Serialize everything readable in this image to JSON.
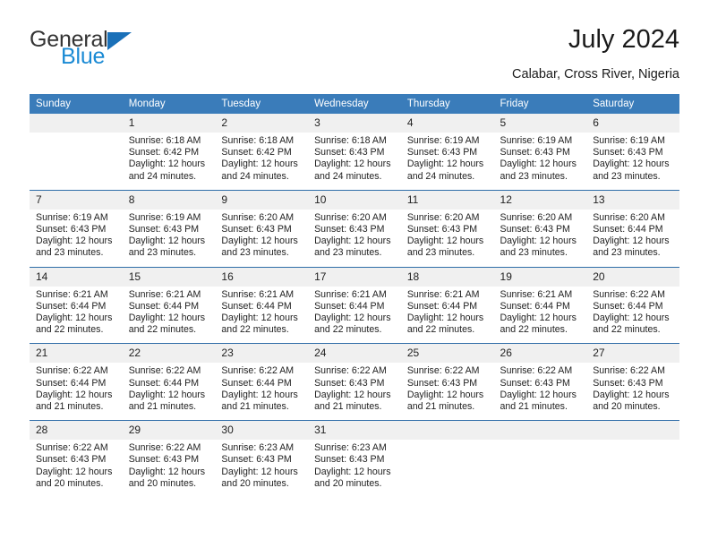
{
  "brand": {
    "name_part1": "General",
    "name_part2": "Blue",
    "triangle_icon": "triangle-icon",
    "accent_color": "#1a8ad4",
    "triangle_color": "#1a70b8"
  },
  "header": {
    "title": "July 2024",
    "location": "Calabar, Cross River, Nigeria"
  },
  "theme": {
    "header_bg": "#3a7cba",
    "row_divider": "#2f6da8",
    "daynum_bg": "#f0f0f0"
  },
  "weekdays": [
    "Sunday",
    "Monday",
    "Tuesday",
    "Wednesday",
    "Thursday",
    "Friday",
    "Saturday"
  ],
  "labels": {
    "sunrise_prefix": "Sunrise: ",
    "sunset_prefix": "Sunset: ",
    "daylight_prefix": "Daylight: "
  },
  "weeks": [
    [
      {
        "day": "",
        "sunrise": "",
        "sunset": "",
        "daylight_line1": "",
        "daylight_line2": "",
        "empty": true
      },
      {
        "day": "1",
        "sunrise": "Sunrise: 6:18 AM",
        "sunset": "Sunset: 6:42 PM",
        "daylight_line1": "Daylight: 12 hours",
        "daylight_line2": "and 24 minutes."
      },
      {
        "day": "2",
        "sunrise": "Sunrise: 6:18 AM",
        "sunset": "Sunset: 6:42 PM",
        "daylight_line1": "Daylight: 12 hours",
        "daylight_line2": "and 24 minutes."
      },
      {
        "day": "3",
        "sunrise": "Sunrise: 6:18 AM",
        "sunset": "Sunset: 6:43 PM",
        "daylight_line1": "Daylight: 12 hours",
        "daylight_line2": "and 24 minutes."
      },
      {
        "day": "4",
        "sunrise": "Sunrise: 6:19 AM",
        "sunset": "Sunset: 6:43 PM",
        "daylight_line1": "Daylight: 12 hours",
        "daylight_line2": "and 24 minutes."
      },
      {
        "day": "5",
        "sunrise": "Sunrise: 6:19 AM",
        "sunset": "Sunset: 6:43 PM",
        "daylight_line1": "Daylight: 12 hours",
        "daylight_line2": "and 23 minutes."
      },
      {
        "day": "6",
        "sunrise": "Sunrise: 6:19 AM",
        "sunset": "Sunset: 6:43 PM",
        "daylight_line1": "Daylight: 12 hours",
        "daylight_line2": "and 23 minutes."
      }
    ],
    [
      {
        "day": "7",
        "sunrise": "Sunrise: 6:19 AM",
        "sunset": "Sunset: 6:43 PM",
        "daylight_line1": "Daylight: 12 hours",
        "daylight_line2": "and 23 minutes."
      },
      {
        "day": "8",
        "sunrise": "Sunrise: 6:19 AM",
        "sunset": "Sunset: 6:43 PM",
        "daylight_line1": "Daylight: 12 hours",
        "daylight_line2": "and 23 minutes."
      },
      {
        "day": "9",
        "sunrise": "Sunrise: 6:20 AM",
        "sunset": "Sunset: 6:43 PM",
        "daylight_line1": "Daylight: 12 hours",
        "daylight_line2": "and 23 minutes."
      },
      {
        "day": "10",
        "sunrise": "Sunrise: 6:20 AM",
        "sunset": "Sunset: 6:43 PM",
        "daylight_line1": "Daylight: 12 hours",
        "daylight_line2": "and 23 minutes."
      },
      {
        "day": "11",
        "sunrise": "Sunrise: 6:20 AM",
        "sunset": "Sunset: 6:43 PM",
        "daylight_line1": "Daylight: 12 hours",
        "daylight_line2": "and 23 minutes."
      },
      {
        "day": "12",
        "sunrise": "Sunrise: 6:20 AM",
        "sunset": "Sunset: 6:43 PM",
        "daylight_line1": "Daylight: 12 hours",
        "daylight_line2": "and 23 minutes."
      },
      {
        "day": "13",
        "sunrise": "Sunrise: 6:20 AM",
        "sunset": "Sunset: 6:44 PM",
        "daylight_line1": "Daylight: 12 hours",
        "daylight_line2": "and 23 minutes."
      }
    ],
    [
      {
        "day": "14",
        "sunrise": "Sunrise: 6:21 AM",
        "sunset": "Sunset: 6:44 PM",
        "daylight_line1": "Daylight: 12 hours",
        "daylight_line2": "and 22 minutes."
      },
      {
        "day": "15",
        "sunrise": "Sunrise: 6:21 AM",
        "sunset": "Sunset: 6:44 PM",
        "daylight_line1": "Daylight: 12 hours",
        "daylight_line2": "and 22 minutes."
      },
      {
        "day": "16",
        "sunrise": "Sunrise: 6:21 AM",
        "sunset": "Sunset: 6:44 PM",
        "daylight_line1": "Daylight: 12 hours",
        "daylight_line2": "and 22 minutes."
      },
      {
        "day": "17",
        "sunrise": "Sunrise: 6:21 AM",
        "sunset": "Sunset: 6:44 PM",
        "daylight_line1": "Daylight: 12 hours",
        "daylight_line2": "and 22 minutes."
      },
      {
        "day": "18",
        "sunrise": "Sunrise: 6:21 AM",
        "sunset": "Sunset: 6:44 PM",
        "daylight_line1": "Daylight: 12 hours",
        "daylight_line2": "and 22 minutes."
      },
      {
        "day": "19",
        "sunrise": "Sunrise: 6:21 AM",
        "sunset": "Sunset: 6:44 PM",
        "daylight_line1": "Daylight: 12 hours",
        "daylight_line2": "and 22 minutes."
      },
      {
        "day": "20",
        "sunrise": "Sunrise: 6:22 AM",
        "sunset": "Sunset: 6:44 PM",
        "daylight_line1": "Daylight: 12 hours",
        "daylight_line2": "and 22 minutes."
      }
    ],
    [
      {
        "day": "21",
        "sunrise": "Sunrise: 6:22 AM",
        "sunset": "Sunset: 6:44 PM",
        "daylight_line1": "Daylight: 12 hours",
        "daylight_line2": "and 21 minutes."
      },
      {
        "day": "22",
        "sunrise": "Sunrise: 6:22 AM",
        "sunset": "Sunset: 6:44 PM",
        "daylight_line1": "Daylight: 12 hours",
        "daylight_line2": "and 21 minutes."
      },
      {
        "day": "23",
        "sunrise": "Sunrise: 6:22 AM",
        "sunset": "Sunset: 6:44 PM",
        "daylight_line1": "Daylight: 12 hours",
        "daylight_line2": "and 21 minutes."
      },
      {
        "day": "24",
        "sunrise": "Sunrise: 6:22 AM",
        "sunset": "Sunset: 6:43 PM",
        "daylight_line1": "Daylight: 12 hours",
        "daylight_line2": "and 21 minutes."
      },
      {
        "day": "25",
        "sunrise": "Sunrise: 6:22 AM",
        "sunset": "Sunset: 6:43 PM",
        "daylight_line1": "Daylight: 12 hours",
        "daylight_line2": "and 21 minutes."
      },
      {
        "day": "26",
        "sunrise": "Sunrise: 6:22 AM",
        "sunset": "Sunset: 6:43 PM",
        "daylight_line1": "Daylight: 12 hours",
        "daylight_line2": "and 21 minutes."
      },
      {
        "day": "27",
        "sunrise": "Sunrise: 6:22 AM",
        "sunset": "Sunset: 6:43 PM",
        "daylight_line1": "Daylight: 12 hours",
        "daylight_line2": "and 20 minutes."
      }
    ],
    [
      {
        "day": "28",
        "sunrise": "Sunrise: 6:22 AM",
        "sunset": "Sunset: 6:43 PM",
        "daylight_line1": "Daylight: 12 hours",
        "daylight_line2": "and 20 minutes."
      },
      {
        "day": "29",
        "sunrise": "Sunrise: 6:22 AM",
        "sunset": "Sunset: 6:43 PM",
        "daylight_line1": "Daylight: 12 hours",
        "daylight_line2": "and 20 minutes."
      },
      {
        "day": "30",
        "sunrise": "Sunrise: 6:23 AM",
        "sunset": "Sunset: 6:43 PM",
        "daylight_line1": "Daylight: 12 hours",
        "daylight_line2": "and 20 minutes."
      },
      {
        "day": "31",
        "sunrise": "Sunrise: 6:23 AM",
        "sunset": "Sunset: 6:43 PM",
        "daylight_line1": "Daylight: 12 hours",
        "daylight_line2": "and 20 minutes."
      },
      {
        "day": "",
        "sunrise": "",
        "sunset": "",
        "daylight_line1": "",
        "daylight_line2": "",
        "empty": true
      },
      {
        "day": "",
        "sunrise": "",
        "sunset": "",
        "daylight_line1": "",
        "daylight_line2": "",
        "empty": true
      },
      {
        "day": "",
        "sunrise": "",
        "sunset": "",
        "daylight_line1": "",
        "daylight_line2": "",
        "empty": true
      }
    ]
  ]
}
